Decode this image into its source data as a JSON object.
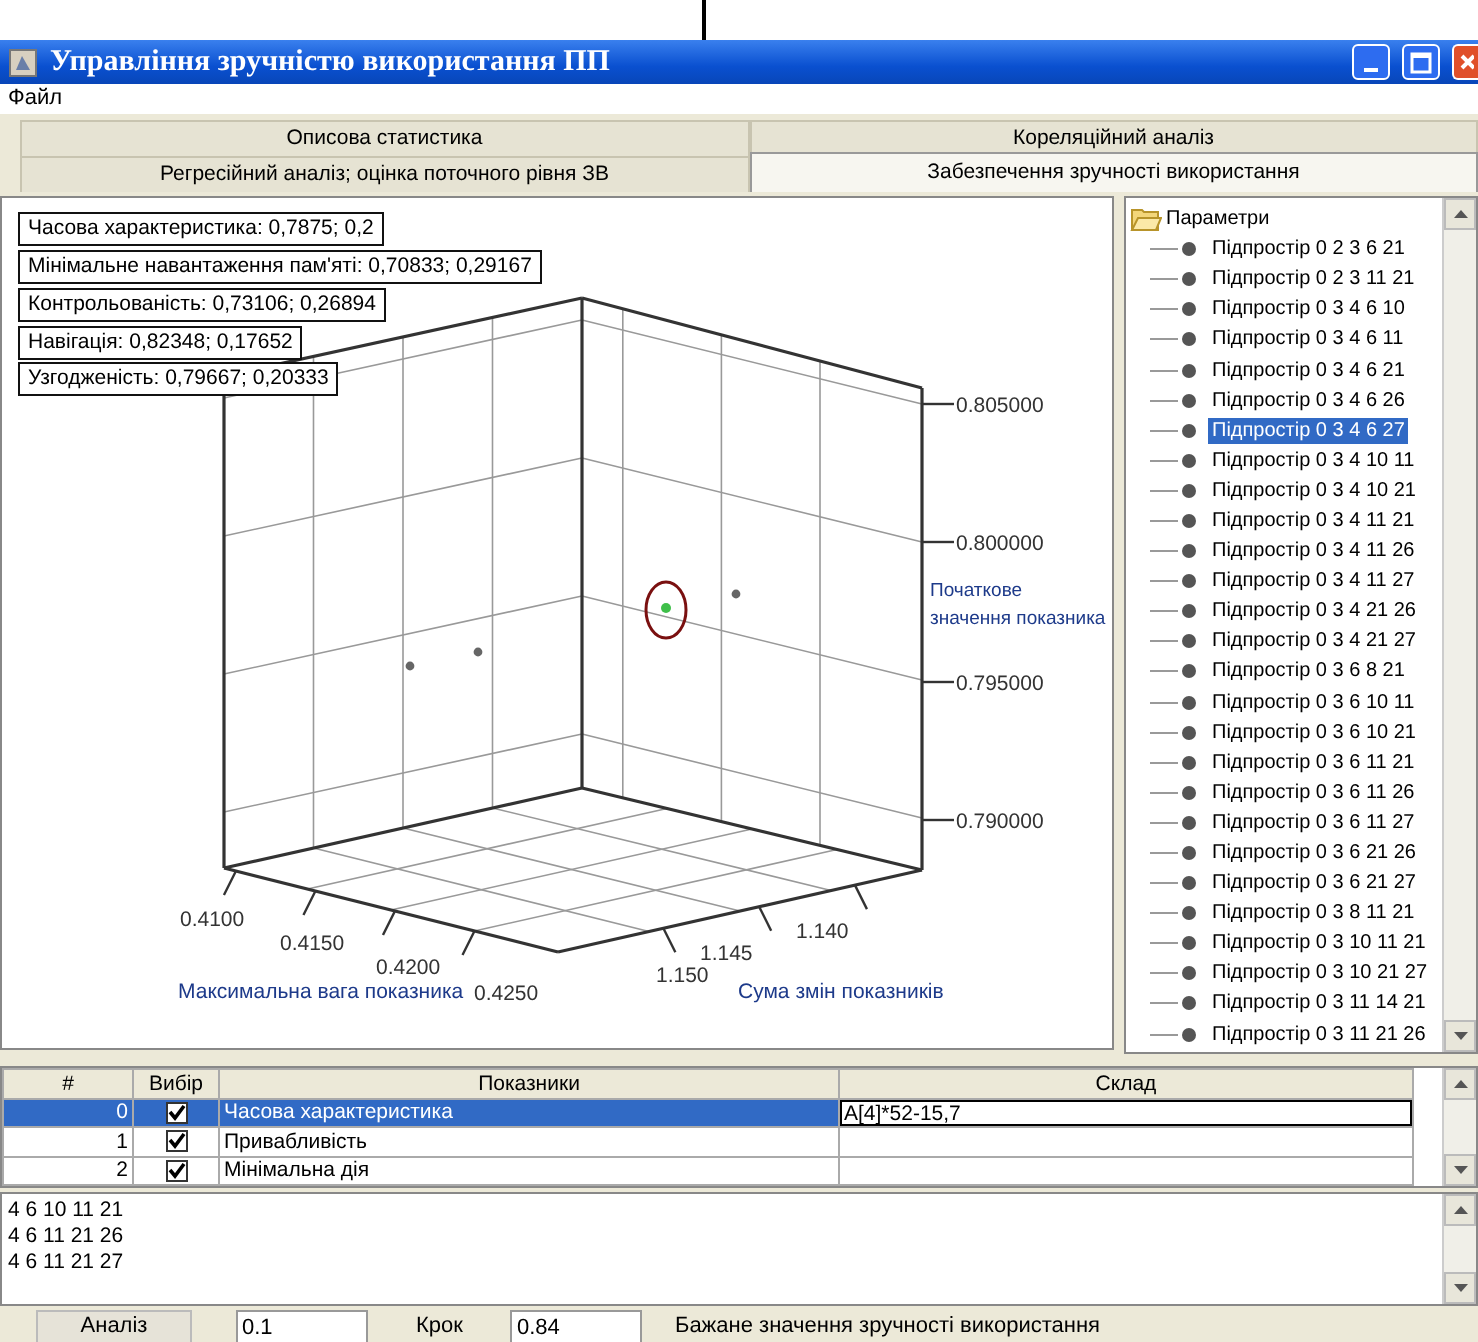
{
  "window": {
    "title": "Управління зручністю використання ПП"
  },
  "menu": [
    "Файл"
  ],
  "tab_rows": [
    {
      "tabs": [
        {
          "label": "Описова статистика",
          "selected": false
        },
        {
          "label": "Кореляційний аналіз",
          "selected": false
        }
      ]
    },
    {
      "tabs": [
        {
          "label": "Регресійний аналіз; оцінка поточного рівня ЗВ",
          "selected": false
        },
        {
          "label": "Забезпечення зручності використання",
          "selected": true
        }
      ]
    }
  ],
  "chart": {
    "legend": [
      "Часова характеристика: 0,7875; 0,2",
      "Мінімальне навантаження пам'яті: 0,70833; 0,29167",
      "Контрольованість: 0,73106; 0,26894",
      "Навігація: 0,82348; 0,17652",
      "Узгодженість: 0,79667; 0,20333"
    ],
    "z_axis": {
      "label_lines": [
        "Початкове",
        "значення показника"
      ],
      "ticks": [
        "0.805000",
        "0.800000",
        "0.795000",
        "0.790000"
      ]
    },
    "x_axis": {
      "label": "Максимальна вага показника",
      "ticks": [
        "0.4100",
        "0.4150",
        "0.4200",
        "0.4250"
      ]
    },
    "y_axis": {
      "label": "Сума змін показників",
      "ticks": [
        "1.140",
        "1.145",
        "1.150"
      ]
    }
  },
  "tree": {
    "label": "Параметри",
    "expanded": true,
    "children": [
      {
        "label": "Підпростір 0 2 3 6 21",
        "selected": false
      },
      {
        "label": "Підпростір 0 2 3 11 21",
        "selected": false
      },
      {
        "label": "Підпростір 0 3 4 6 10",
        "selected": false
      },
      {
        "label": "Підпростір 0 3 4 6 11",
        "selected": false
      },
      {
        "label": "Підпростір 0 3 4 6 21",
        "selected": false
      },
      {
        "label": "Підпростір 0 3 4 6 26",
        "selected": false
      },
      {
        "label": "Підпростір 0 3 4 6 27",
        "selected": true
      },
      {
        "label": "Підпростір 0 3 4 10 11",
        "selected": false
      },
      {
        "label": "Підпростір 0 3 4 10 21",
        "selected": false
      },
      {
        "label": "Підпростір 0 3 4 11 21",
        "selected": false
      },
      {
        "label": "Підпростір 0 3 4 11 26",
        "selected": false
      },
      {
        "label": "Підпростір 0 3 4 11 27",
        "selected": false
      },
      {
        "label": "Підпростір 0 3 4 21 26",
        "selected": false
      },
      {
        "label": "Підпростір 0 3 4 21 27",
        "selected": false
      },
      {
        "label": "Підпростір 0 3 6 8 21",
        "selected": false
      },
      {
        "label": "Підпростір 0 3 6 10 11",
        "selected": false
      },
      {
        "label": "Підпростір 0 3 6 10 21",
        "selected": false
      },
      {
        "label": "Підпростір 0 3 6 11 21",
        "selected": false
      },
      {
        "label": "Підпростір 0 3 6 11 26",
        "selected": false
      },
      {
        "label": "Підпростір 0 3 6 11 27",
        "selected": false
      },
      {
        "label": "Підпростір 0 3 6 21 26",
        "selected": false
      },
      {
        "label": "Підпростір 0 3 6 21 27",
        "selected": false
      },
      {
        "label": "Підпростір 0 3 8 11 21",
        "selected": false
      },
      {
        "label": "Підпростір 0 3 10 11 21",
        "selected": false
      },
      {
        "label": "Підпростір 0 3 10 21 27",
        "selected": false
      },
      {
        "label": "Підпростір 0 3 11 14 21",
        "selected": false
      },
      {
        "label": "Підпростір 0 3 11 21 26",
        "selected": false
      }
    ]
  },
  "table": {
    "columns": [
      "#",
      "Вибір",
      "Показники",
      "Склад"
    ],
    "rows": [
      {
        "index": "0",
        "checked": true,
        "name": "Часова характеристика",
        "composition": "A[4]*52-15,7",
        "selected": true
      },
      {
        "index": "1",
        "checked": true,
        "name": "Привабливість",
        "selected": false
      },
      {
        "index": "2",
        "checked": true,
        "name": "Мінімальна дія",
        "selected": false
      }
    ]
  },
  "results": [
    "4 6 10 11 21",
    "4 6 11 21 26",
    "4 6 11 21 27"
  ],
  "bottom": {
    "button": "Аналіз",
    "value_1": "0.1",
    "step_label": "Крок",
    "value_2": "0.84",
    "caption": "Бажане значення зручності використання"
  }
}
